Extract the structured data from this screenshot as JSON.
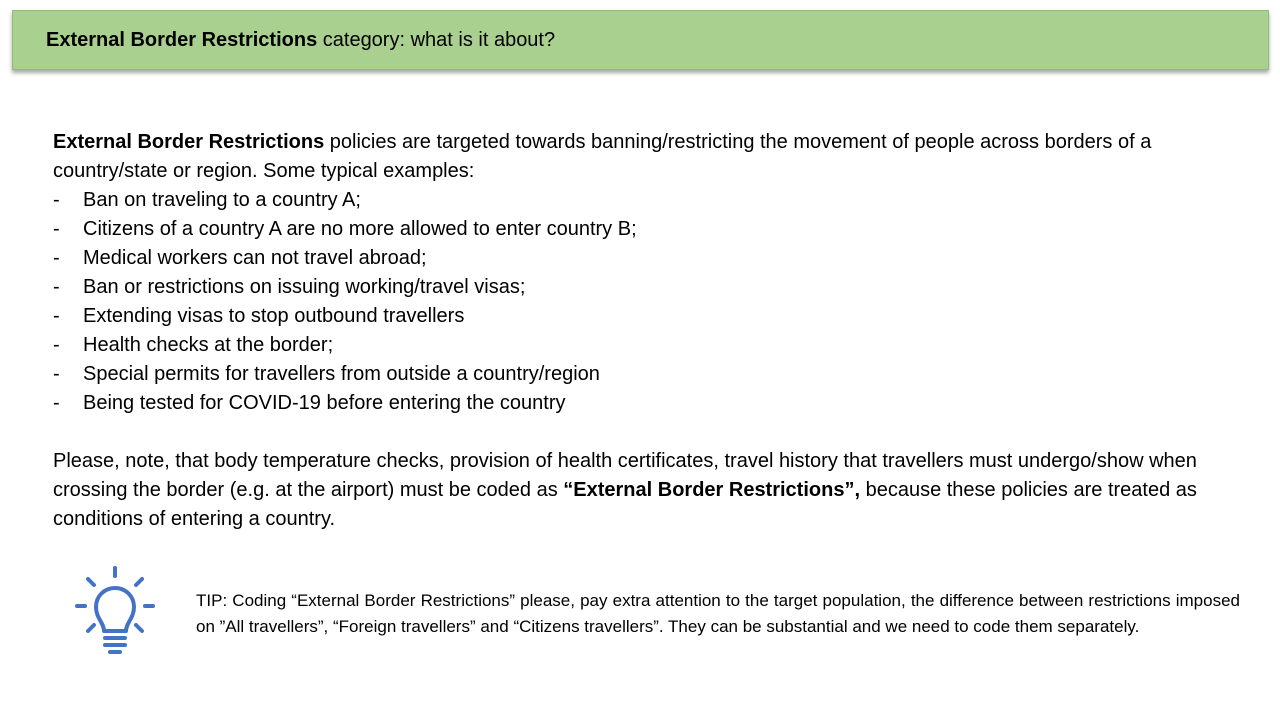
{
  "header": {
    "title_bold": "External Border Restrictions",
    "title_rest": " category: what is it about?",
    "bar_color": "#a9d08e"
  },
  "intro": {
    "lead_bold": "External Border Restrictions",
    "lead_rest": " policies are targeted towards banning/restricting the movement of people across borders of a country/state or region.  Some typical examples:"
  },
  "examples": {
    "bullet": "-",
    "items": [
      "Ban on traveling to a country A;",
      "Citizens of a country A are no more allowed to enter country B;",
      "Medical workers can not travel abroad;",
      "Ban or restrictions on issuing working/travel visas;",
      "Extending visas to stop outbound travellers",
      "Health checks at the border;",
      "Special permits for travellers from outside a country/region",
      "Being tested for COVID-19 before entering the country"
    ]
  },
  "note": {
    "text_before": "Please, note, that body temperature checks, provision of health certificates, travel history that travellers must undergo/show when crossing the border (e.g. at the airport) must be coded as ",
    "text_bold": "“External Border Restrictions”,",
    "text_after": " because these policies are treated as conditions of entering a country."
  },
  "tip": {
    "icon": "lightbulb-icon",
    "icon_color": "#4472c4",
    "text": "TIP: Coding “External Border Restrictions” please, pay extra attention to the target population, the difference between restrictions imposed on ”All travellers”, “Foreign travellers” and “Citizens travellers”. They can be substantial and we need to code them separately."
  }
}
